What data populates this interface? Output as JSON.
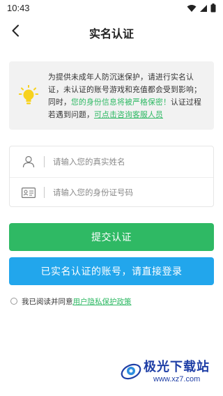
{
  "status_bar": {
    "time": "10:43",
    "icons": [
      "wifi-icon",
      "signal-icon",
      "battery-icon"
    ]
  },
  "header": {
    "title": "实名认证",
    "back_icon": "back-chevron-icon"
  },
  "notice": {
    "icon": "lightbulb-icon",
    "text_plain": "为提供未成年人防沉迷保护，请进行实名认证，未认证的账号游戏和充值都会受到影响；同时，",
    "text_green": "您的身份信息将被严格保密！",
    "text_plain2": "认证过程若遇到问题，",
    "link": "可点击咨询客服人员"
  },
  "form": {
    "name_placeholder": "请输入您的真实姓名",
    "name_value": "",
    "id_placeholder": "请输入您的身份证号码",
    "id_value": ""
  },
  "buttons": {
    "submit_label": "提交认证",
    "login_label": "已实名认证的账号，请直接登录"
  },
  "agreement": {
    "prefix": "我已阅读并同意",
    "policy_link": "用户隐私保护政策"
  },
  "watermark": {
    "title": "极光下载站",
    "url": "www.xz7.com"
  },
  "colors": {
    "primary_green": "#2fb964",
    "secondary_blue": "#22a6ec",
    "notice_bg": "#f2f2f2",
    "bulb_yellow": "#f7d21e"
  }
}
